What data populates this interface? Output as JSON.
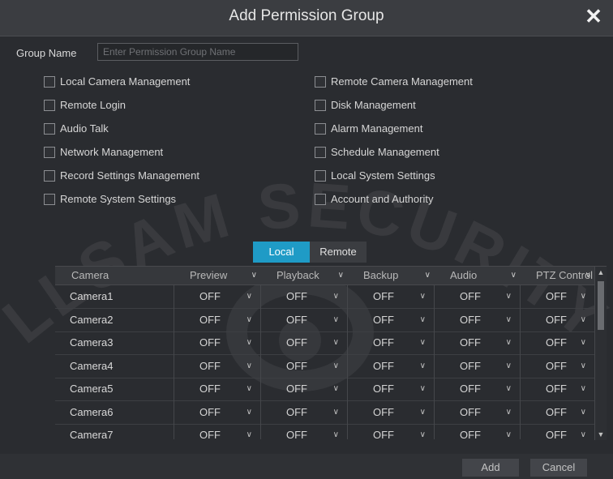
{
  "dialog": {
    "title": "Add Permission Group",
    "close_glyph": "✕"
  },
  "group_name": {
    "label": "Group Name",
    "value": "",
    "placeholder": "Enter Permission Group Name"
  },
  "permissions": {
    "left": [
      {
        "label": "Local Camera Management",
        "checked": false
      },
      {
        "label": "Remote Login",
        "checked": false
      },
      {
        "label": "Audio Talk",
        "checked": false
      },
      {
        "label": "Network Management",
        "checked": false
      },
      {
        "label": "Record Settings Management",
        "checked": false
      },
      {
        "label": "Remote System Settings",
        "checked": false
      }
    ],
    "right": [
      {
        "label": "Remote Camera Management",
        "checked": false
      },
      {
        "label": "Disk Management",
        "checked": false
      },
      {
        "label": "Alarm Management",
        "checked": false
      },
      {
        "label": "Schedule Management",
        "checked": false
      },
      {
        "label": "Local System Settings",
        "checked": false
      },
      {
        "label": "Account and Authority",
        "checked": false
      }
    ]
  },
  "tabs": [
    {
      "label": "Local",
      "active": true
    },
    {
      "label": "Remote",
      "active": false
    }
  ],
  "table": {
    "columns": [
      "Camera",
      "Preview",
      "Playback",
      "Backup",
      "Audio",
      "PTZ Control"
    ],
    "rows": [
      {
        "camera": "Camera1",
        "values": [
          "OFF",
          "OFF",
          "OFF",
          "OFF",
          "OFF"
        ]
      },
      {
        "camera": "Camera2",
        "values": [
          "OFF",
          "OFF",
          "OFF",
          "OFF",
          "OFF"
        ]
      },
      {
        "camera": "Camera3",
        "values": [
          "OFF",
          "OFF",
          "OFF",
          "OFF",
          "OFF"
        ]
      },
      {
        "camera": "Camera4",
        "values": [
          "OFF",
          "OFF",
          "OFF",
          "OFF",
          "OFF"
        ]
      },
      {
        "camera": "Camera5",
        "values": [
          "OFF",
          "OFF",
          "OFF",
          "OFF",
          "OFF"
        ]
      },
      {
        "camera": "Camera6",
        "values": [
          "OFF",
          "OFF",
          "OFF",
          "OFF",
          "OFF"
        ]
      },
      {
        "camera": "Camera7",
        "values": [
          "OFF",
          "OFF",
          "OFF",
          "OFF",
          "OFF"
        ]
      }
    ]
  },
  "buttons": {
    "add": "Add",
    "cancel": "Cancel"
  },
  "watermark": {
    "text": "LLSAM SECURITY"
  },
  "colors": {
    "accent": "#1f9bc6",
    "background": "#2a2c30",
    "titlebar": "#3b3d41"
  },
  "icons": {
    "close": "close-icon",
    "chevron": "chevron-down-icon",
    "scroll_up": "chevron-up-icon"
  }
}
